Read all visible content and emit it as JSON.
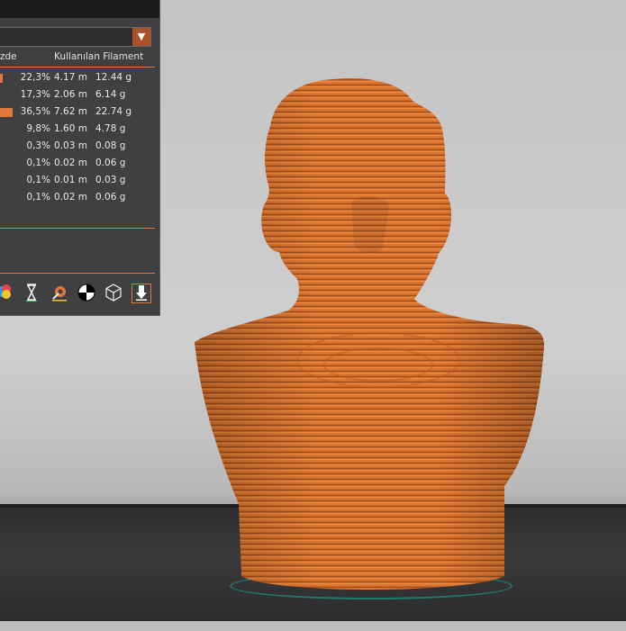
{
  "panel": {
    "header_left": "zde",
    "header_right": "Kullanılan Filament",
    "rows": [
      {
        "percent": "22,3%",
        "length": "4.17 m",
        "weight": "12.44 g",
        "swatch": true
      },
      {
        "percent": "17,3%",
        "length": "2.06 m",
        "weight": "6.14 g",
        "swatch": false
      },
      {
        "percent": "36,5%",
        "length": "7.62 m",
        "weight": "22.74 g",
        "swatch": true
      },
      {
        "percent": "9,8%",
        "length": "1.60 m",
        "weight": "4.78 g",
        "swatch": false
      },
      {
        "percent": "0,3%",
        "length": "0.03 m",
        "weight": "0.08 g",
        "swatch": false
      },
      {
        "percent": "0,1%",
        "length": "0.02 m",
        "weight": "0.06 g",
        "swatch": false
      },
      {
        "percent": "0,1%",
        "length": "0.01 m",
        "weight": "0.03 g",
        "swatch": false
      },
      {
        "percent": "0,1%",
        "length": "0.02 m",
        "weight": "0.06 g",
        "swatch": false
      }
    ],
    "dropdown_arrow": "▼",
    "toolbar_icons": [
      "color-wheel-icon",
      "hourglass-icon",
      "settings-gear-icon",
      "center-target-icon",
      "cube-wireframe-icon",
      "export-arrow-icon"
    ]
  },
  "colors": {
    "accent": "#e2783e",
    "panel_bg": "#404042",
    "model": "#d9722e",
    "dropdown_button": "#a9522a"
  }
}
